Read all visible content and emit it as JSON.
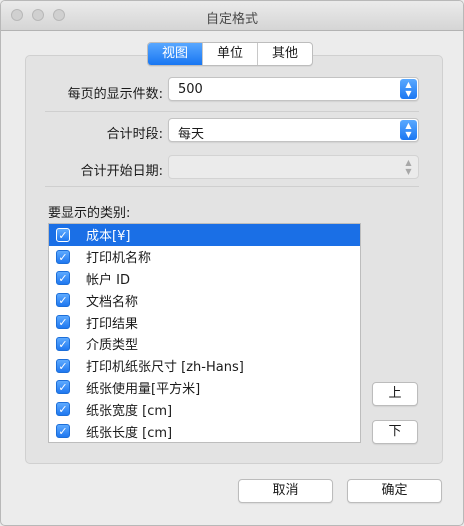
{
  "window": {
    "title": "自定格式"
  },
  "tabs": [
    {
      "label": "视图",
      "active": true
    },
    {
      "label": "单位",
      "active": false
    },
    {
      "label": "其他",
      "active": false
    }
  ],
  "fields": {
    "per_page": {
      "label": "每页的显示件数:",
      "value": "500"
    },
    "period": {
      "label": "合计时段:",
      "value": "每天"
    },
    "start_date": {
      "label": "合计开始日期:",
      "value": "",
      "disabled": true
    }
  },
  "categories": {
    "label": "要显示的类别:",
    "items": [
      {
        "label": "成本[¥]",
        "checked": true,
        "selected": true
      },
      {
        "label": "打印机名称",
        "checked": true
      },
      {
        "label": "帐户 ID",
        "checked": true
      },
      {
        "label": "文档名称",
        "checked": true
      },
      {
        "label": "打印结果",
        "checked": true
      },
      {
        "label": "介质类型",
        "checked": true
      },
      {
        "label": "打印机纸张尺寸 [zh-Hans]",
        "checked": true
      },
      {
        "label": "纸张使用量[平方米]",
        "checked": true
      },
      {
        "label": "纸张宽度 [cm]",
        "checked": true
      },
      {
        "label": "纸张长度 [cm]",
        "checked": true
      }
    ]
  },
  "buttons": {
    "up": "上",
    "down": "下",
    "cancel": "取消",
    "ok": "确定"
  },
  "colors": {
    "accent": "#1a6fe6",
    "window_bg": "#ececec"
  }
}
